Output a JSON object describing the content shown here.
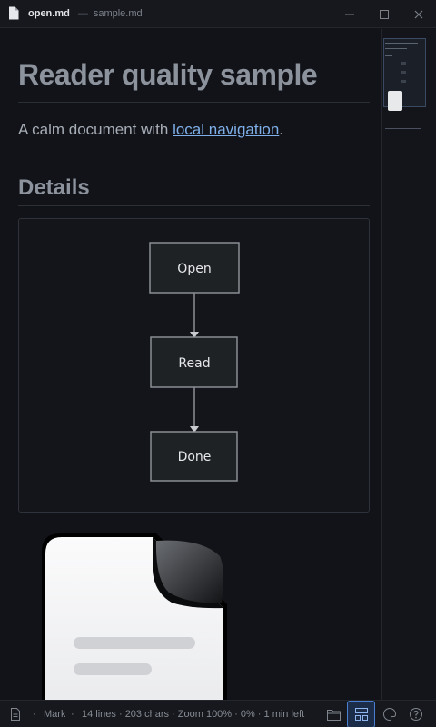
{
  "window": {
    "title": "open.md",
    "separator": "—",
    "subtitle": "sample.md"
  },
  "document": {
    "heading": "Reader quality sample",
    "paragraph_prefix": "A calm document with ",
    "paragraph_link": "local navigation",
    "paragraph_suffix": ".",
    "subheading": "Details",
    "diagram": {
      "nodes": [
        "Open",
        "Read",
        "Done"
      ]
    }
  },
  "statusbar": {
    "mode": "Mark",
    "stats": "14 lines · 203 chars · Zoom 100% · 0% · 1 min left"
  },
  "colors": {
    "background": "#111318",
    "link": "#7fb0ea",
    "accent": "#4a7fd0",
    "node_fill": "#1f2224",
    "node_border": "#8a8f95"
  },
  "icons": {
    "title": "file-icon",
    "minimize": "minimize-icon",
    "maximize": "maximize-icon",
    "close": "close-icon",
    "status_file": "file-text-icon",
    "folder": "folder-icon",
    "layout": "layout-icon",
    "theme": "palette-icon",
    "help": "help-icon"
  }
}
